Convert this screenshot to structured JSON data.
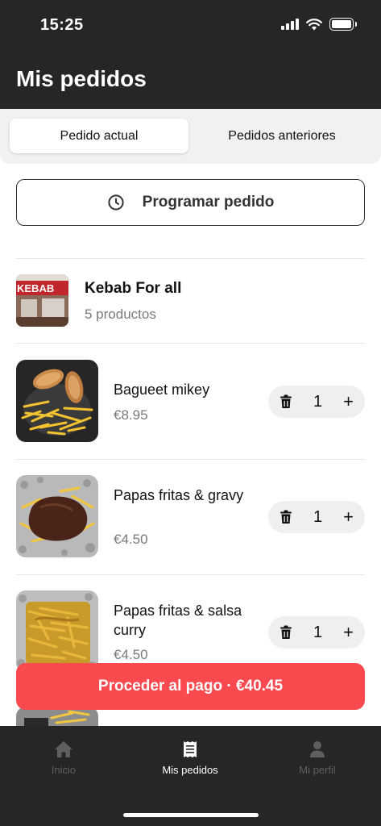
{
  "status_bar": {
    "time": "15:25"
  },
  "header": {
    "title": "Mis pedidos"
  },
  "segments": [
    {
      "label": "Pedido actual",
      "active": true
    },
    {
      "label": "Pedidos anteriores",
      "active": false
    }
  ],
  "schedule": {
    "label": "Programar pedido",
    "icon": "clock-icon"
  },
  "restaurant": {
    "name": "Kebab For all",
    "count": "5 productos",
    "sign_text": "KEBAB"
  },
  "items": [
    {
      "name": "Bagueet mikey",
      "price": "€8.95",
      "quantity": "1"
    },
    {
      "name": "Papas fritas & gravy",
      "price": "€4.50",
      "quantity": "1"
    },
    {
      "name": "Papas fritas & salsa curry",
      "price": "€4.50",
      "quantity": "1"
    }
  ],
  "checkout": {
    "label": "Proceder al pago · €40.45"
  },
  "tabbar": [
    {
      "label": "Inicio",
      "icon": "home-icon",
      "active": false
    },
    {
      "label": "Mis pedidos",
      "icon": "receipt-icon",
      "active": true
    },
    {
      "label": "Mi perfil",
      "icon": "user-icon",
      "active": false
    }
  ],
  "colors": {
    "dark": "#262626",
    "accent": "#fb4a4f",
    "segment_bg": "#f1f1f1",
    "stepper_bg": "#efefef"
  }
}
